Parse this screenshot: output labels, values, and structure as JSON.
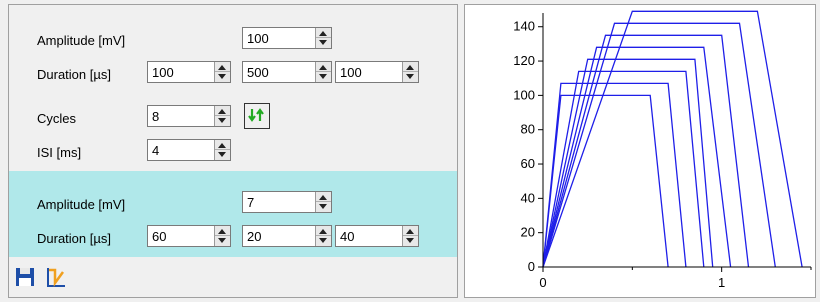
{
  "stim1": {
    "amplitude_label": "Amplitude [mV]",
    "amplitude_value": "100",
    "duration_label": "Duration [µs]",
    "duration_values": [
      "100",
      "500",
      "100"
    ],
    "cycles_label": "Cycles",
    "cycles_value": "8",
    "isi_label": "ISI [ms]",
    "isi_value": "4"
  },
  "stim2": {
    "amplitude_label": "Amplitude [mV]",
    "amplitude_value": "7",
    "duration_label": "Duration [µs]",
    "duration_values": [
      "60",
      "20",
      "40"
    ]
  },
  "icons": {
    "swap": "swap-arrows-icon",
    "save": "save-icon",
    "plot": "plot-icon"
  },
  "colors": {
    "stim2_background": "#b0e8ea",
    "trace": "#1f1fe8",
    "swap_arrows": "#22aa22"
  },
  "chart_data": {
    "type": "line",
    "xlim": [
      0,
      1.5
    ],
    "ylim": [
      0,
      148
    ],
    "xticks": [
      "0",
      "1"
    ],
    "yticks": [
      "0",
      "20",
      "40",
      "60",
      "80",
      "100",
      "120",
      "140"
    ],
    "grid": false,
    "series": [
      {
        "x": [
          0,
          0.1,
          0.6,
          0.7
        ],
        "y": [
          0,
          100,
          100,
          0
        ]
      },
      {
        "x": [
          0,
          0.1,
          0.7,
          0.8
        ],
        "y": [
          0,
          107,
          107,
          0
        ]
      },
      {
        "x": [
          0,
          0.2,
          0.8,
          0.9
        ],
        "y": [
          0,
          114,
          114,
          0
        ]
      },
      {
        "x": [
          0,
          0.25,
          0.85,
          0.95
        ],
        "y": [
          0,
          121,
          121,
          0
        ]
      },
      {
        "x": [
          0,
          0.3,
          0.9,
          1.05
        ],
        "y": [
          0,
          128,
          128,
          0
        ]
      },
      {
        "x": [
          0,
          0.35,
          1.0,
          1.15
        ],
        "y": [
          0,
          135,
          135,
          0
        ]
      },
      {
        "x": [
          0,
          0.4,
          1.1,
          1.3
        ],
        "y": [
          0,
          142,
          142,
          0
        ]
      },
      {
        "x": [
          0,
          0.5,
          1.2,
          1.45
        ],
        "y": [
          0,
          149,
          149,
          0
        ]
      }
    ]
  }
}
